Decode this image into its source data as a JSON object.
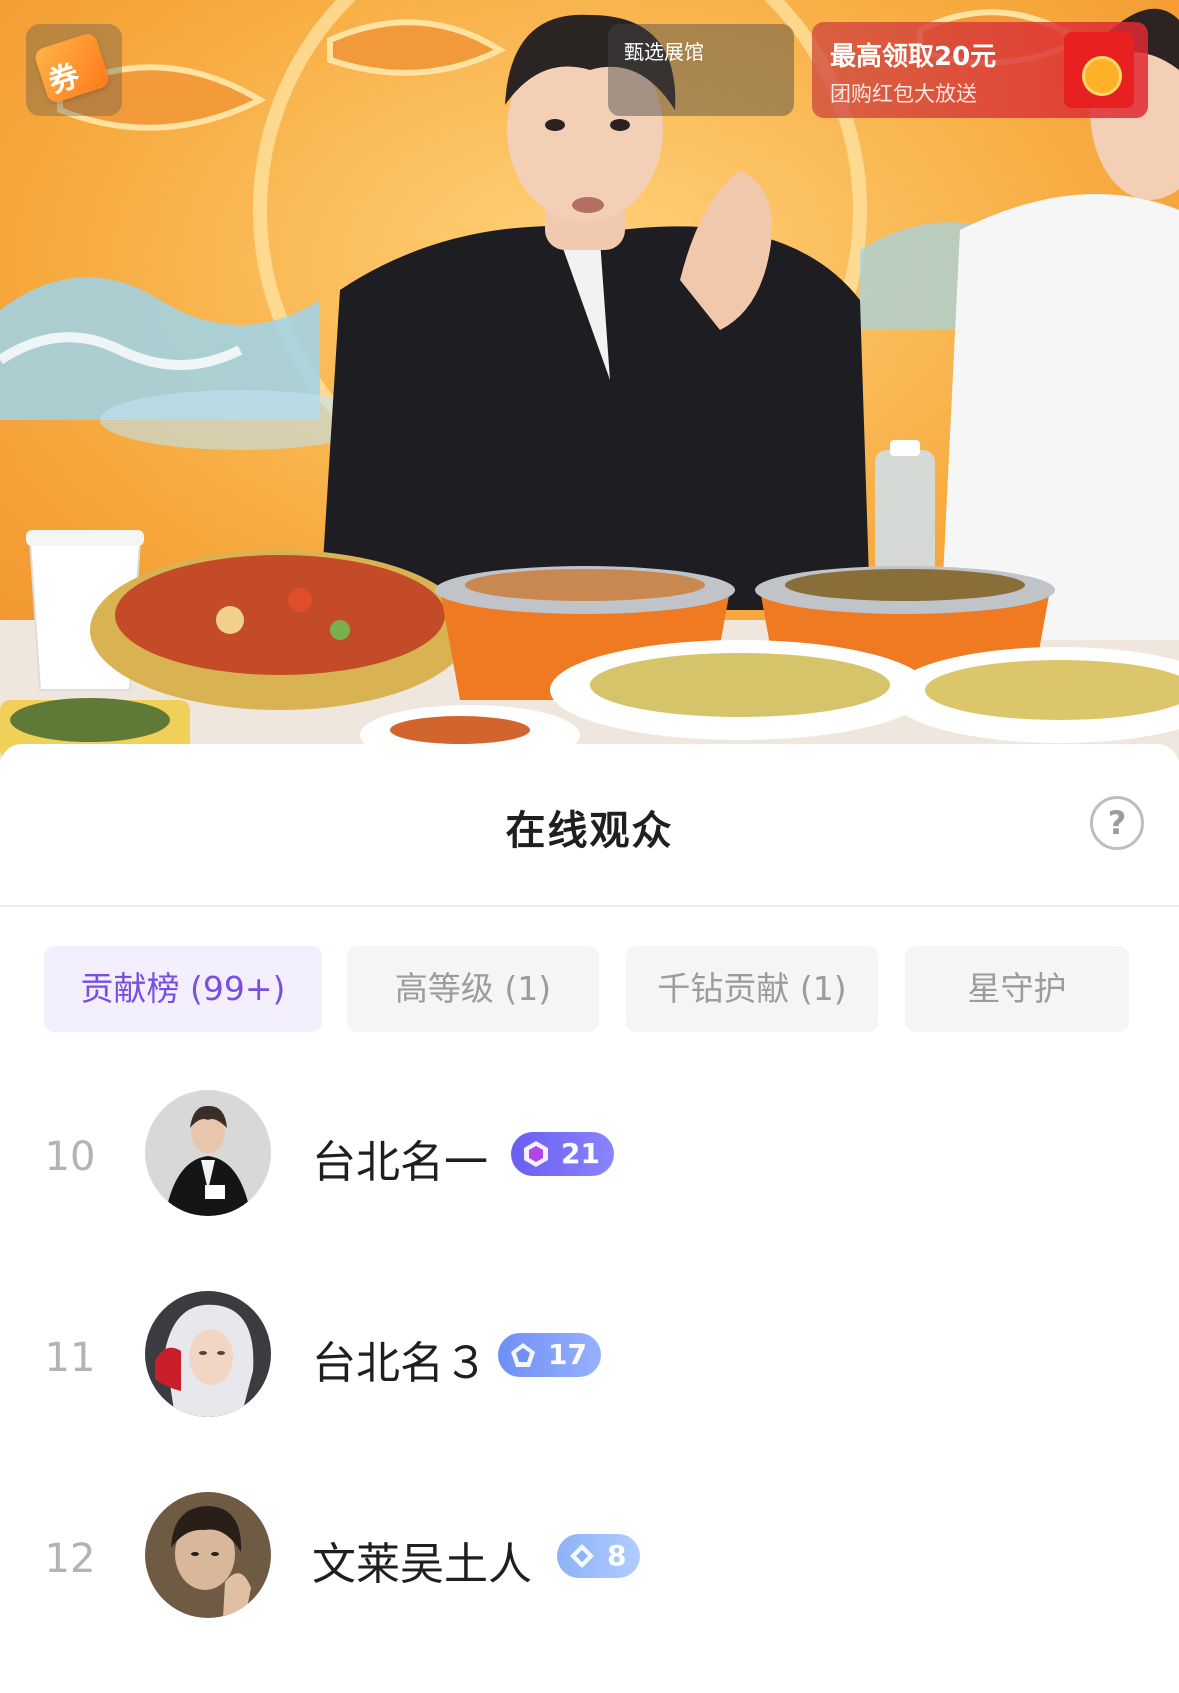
{
  "stream": {
    "coupon_label": "券",
    "showroom_label": "甄选展馆",
    "redpack_title": "最高领取20元",
    "redpack_subtitle": "团购红包大放送"
  },
  "sheet": {
    "title": "在线观众",
    "help_glyph": "?",
    "tabs": [
      {
        "label": "贡献榜 (99+)",
        "active": true
      },
      {
        "label": "高等级 (1)",
        "active": false
      },
      {
        "label": "千钻贡献 (1)",
        "active": false
      },
      {
        "label": "星守护",
        "active": false
      }
    ],
    "viewers": [
      {
        "rank": "10",
        "name": "台北名一",
        "level": "21",
        "badge_color": "#6a5df0"
      },
      {
        "rank": "11",
        "name": "台北名３",
        "level": "17",
        "badge_color": "#6f8ff5"
      },
      {
        "rank": "12",
        "name": "文莱吴土人",
        "level": "8",
        "badge_color": "#8cb2f7"
      }
    ]
  },
  "colors": {
    "accent_purple": "#7a4fe0",
    "tab_active_bg": "#f4efff",
    "tab_bg": "#f5f5f6"
  }
}
